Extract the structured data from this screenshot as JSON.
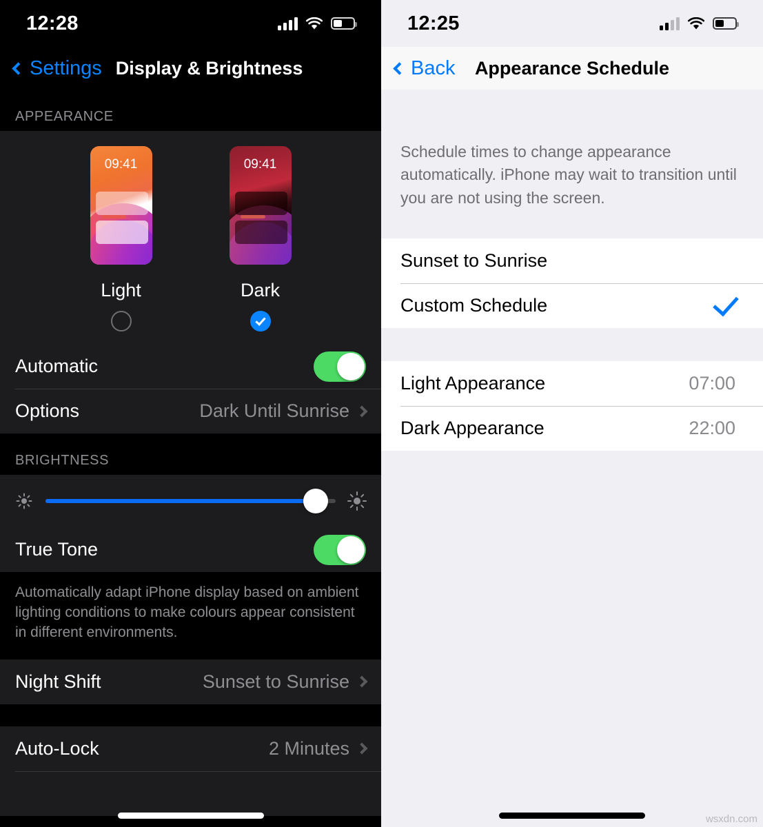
{
  "left_screen": {
    "status_bar": {
      "time": "12:28",
      "cellular_icon": "signal-bars-icon",
      "wifi_icon": "wifi-icon",
      "battery_icon": "battery-icon"
    },
    "nav": {
      "back_label": "Settings",
      "title": "Display & Brightness",
      "back_icon": "chevron-left-icon"
    },
    "appearance_section": {
      "header": "APPEARANCE",
      "options": [
        {
          "label": "Light",
          "clock": "09:41",
          "selected": false
        },
        {
          "label": "Dark",
          "clock": "09:41",
          "selected": true
        }
      ],
      "rows": [
        {
          "label": "Automatic",
          "type": "toggle",
          "value": "on"
        },
        {
          "label": "Options",
          "type": "disclosure",
          "value": "Dark Until Sunrise"
        }
      ]
    },
    "brightness_section": {
      "header": "BRIGHTNESS",
      "slider": {
        "value_percent": 93,
        "min_icon": "sun-small-icon",
        "max_icon": "sun-large-icon"
      },
      "rows": [
        {
          "label": "True Tone",
          "type": "toggle",
          "value": "on"
        }
      ],
      "footer": "Automatically adapt iPhone display based on ambient lighting conditions to make colours appear consistent in different environments."
    },
    "night_shift_section": {
      "rows": [
        {
          "label": "Night Shift",
          "type": "disclosure",
          "value": "Sunset to Sunrise"
        }
      ]
    },
    "autolock_section": {
      "rows": [
        {
          "label": "Auto-Lock",
          "type": "disclosure",
          "value": "2 Minutes"
        }
      ]
    }
  },
  "right_screen": {
    "status_bar": {
      "time": "12:25",
      "cellular_icon": "signal-bars-icon",
      "wifi_icon": "wifi-icon",
      "battery_icon": "battery-icon"
    },
    "nav": {
      "back_label": "Back",
      "title": "Appearance Schedule",
      "back_icon": "chevron-left-icon"
    },
    "description": "Schedule times to change appearance automatically. iPhone may wait to transition until you are not using the screen.",
    "schedule_options": [
      {
        "label": "Sunset to Sunrise",
        "selected": false
      },
      {
        "label": "Custom Schedule",
        "selected": true
      }
    ],
    "times": [
      {
        "label": "Light Appearance",
        "value": "07:00"
      },
      {
        "label": "Dark Appearance",
        "value": "22:00"
      }
    ]
  },
  "watermark": "wsxdn.com",
  "colors": {
    "accent_blue_dark": "#0A84FF",
    "accent_blue_light": "#007AFF",
    "toggle_green": "#4CD964",
    "slider_blue": "#0A6CF5",
    "dark_cell_bg": "#1C1C1E",
    "dark_page_bg": "#000000",
    "light_cell_bg": "#FFFFFF",
    "light_page_bg": "#EFEFF4",
    "secondary_text": "#8E8E93"
  }
}
